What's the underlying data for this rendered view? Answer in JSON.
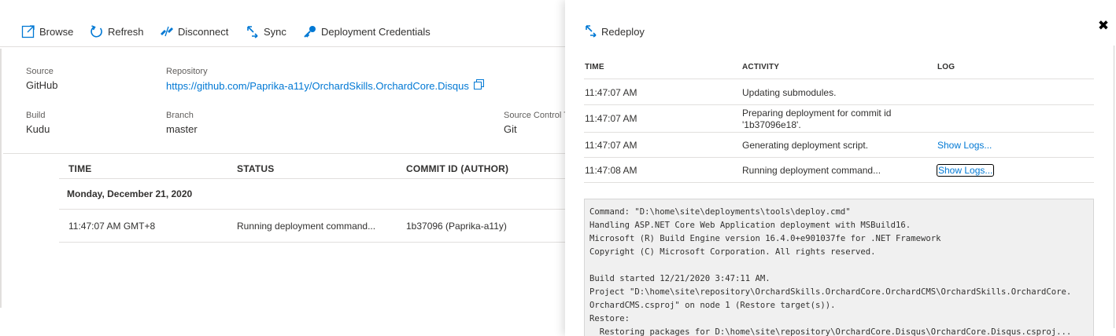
{
  "toolbar": {
    "browse_label": "Browse",
    "refresh_label": "Refresh",
    "disconnect_label": "Disconnect",
    "sync_label": "Sync",
    "credentials_label": "Deployment Credentials"
  },
  "info": {
    "source_label": "Source",
    "source_value": "GitHub",
    "repository_label": "Repository",
    "repository_value": "https://github.com/Paprika-a11y/OrchardSkills.OrchardCore.Disqus",
    "build_label": "Build",
    "build_value": "Kudu",
    "branch_label": "Branch",
    "branch_value": "master",
    "scm_label": "Source Control T",
    "scm_value": "Git"
  },
  "deployments": {
    "columns": [
      "TIME",
      "STATUS",
      "COMMIT ID (AUTHOR)"
    ],
    "group_title": "Monday, December 21, 2020",
    "rows": [
      {
        "time": "11:47:07 AM GMT+8",
        "status": "Running deployment command...",
        "commit": "1b37096 (Paprika-a11y)"
      }
    ]
  },
  "blade": {
    "close_symbol": "✖",
    "redeploy_label": "Redeploy",
    "columns": [
      "TIME",
      "ACTIVITY",
      "LOG"
    ],
    "rows": [
      {
        "time": "11:47:07 AM",
        "activity": "Updating submodules.",
        "log": ""
      },
      {
        "time": "11:47:07 AM",
        "activity": "Preparing deployment for commit id '1b37096e18'.",
        "log": ""
      },
      {
        "time": "11:47:07 AM",
        "activity": "Generating deployment script.",
        "log": "Show Logs..."
      },
      {
        "time": "11:47:08 AM",
        "activity": "Running deployment command...",
        "log": "Show Logs..."
      }
    ],
    "log_lines": [
      "Command: \"D:\\home\\site\\deployments\\tools\\deploy.cmd\"",
      "Handling ASP.NET Core Web Application deployment with MSBuild16.",
      "Microsoft (R) Build Engine version 16.4.0+e901037fe for .NET Framework",
      "Copyright (C) Microsoft Corporation. All rights reserved.",
      "",
      "Build started 12/21/2020 3:47:11 AM.",
      "Project \"D:\\home\\site\\repository\\OrchardSkills.OrchardCore.OrchardCMS\\OrchardSkills.OrchardCore.",
      "OrchardCMS.csproj\" on node 1 (Restore target(s)).",
      "Restore:",
      "  Restoring packages for D:\\home\\site\\repository\\OrchardCore.Disqus\\OrchardCore.Disqus.csproj..."
    ]
  },
  "colors": {
    "accent": "#0078d4",
    "text": "#323130",
    "muted": "#605e5c",
    "border": "#e1dfdd",
    "log_bg": "#f0f0f0"
  },
  "icons": {
    "browse": "browse-icon",
    "refresh": "refresh-icon",
    "disconnect": "disconnect-icon",
    "sync": "sync-icon",
    "credentials": "key-icon",
    "copy": "copy-icon",
    "redeploy": "redeploy-icon",
    "close": "close-icon"
  }
}
